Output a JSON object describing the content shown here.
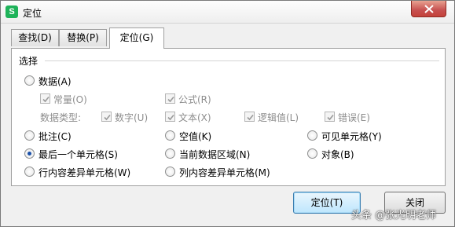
{
  "window": {
    "title": "定位",
    "app_icon": "S"
  },
  "tabs": [
    {
      "label": "查找(D)",
      "active": false
    },
    {
      "label": "替换(P)",
      "active": false
    },
    {
      "label": "定位(G)",
      "active": true
    }
  ],
  "group": {
    "label": "选择"
  },
  "options": {
    "data": {
      "label": "数据(A)",
      "checked": false
    },
    "constant": {
      "label": "常量(O)",
      "checked": true,
      "disabled": true
    },
    "formula": {
      "label": "公式(R)",
      "checked": true,
      "disabled": true
    },
    "data_type_label": "数据类型:",
    "number": {
      "label": "数字(U)",
      "checked": true,
      "disabled": true
    },
    "text": {
      "label": "文本(X)",
      "checked": true,
      "disabled": true
    },
    "logical": {
      "label": "逻辑值(L)",
      "checked": true,
      "disabled": true
    },
    "error": {
      "label": "错误(E)",
      "checked": true,
      "disabled": true
    },
    "comments": {
      "label": "批注(C)",
      "checked": false
    },
    "blanks": {
      "label": "空值(K)",
      "checked": false
    },
    "visible_cells": {
      "label": "可见单元格(Y)",
      "checked": false
    },
    "last_cell": {
      "label": "最后一个单元格(S)",
      "checked": true
    },
    "current_region": {
      "label": "当前数据区域(N)",
      "checked": false
    },
    "objects": {
      "label": "对象(B)",
      "checked": false
    },
    "row_differences": {
      "label": "行内容差异单元格(W)",
      "checked": false
    },
    "column_differences": {
      "label": "列内容差异单元格(M)",
      "checked": false
    }
  },
  "buttons": {
    "goto": "定位(T)",
    "close": "关闭"
  },
  "watermark": "头条 @张光明老师",
  "colors": {
    "close_button": "#c75050",
    "radio_dot": "#1a50a8",
    "default_button": "#bee6fd"
  }
}
